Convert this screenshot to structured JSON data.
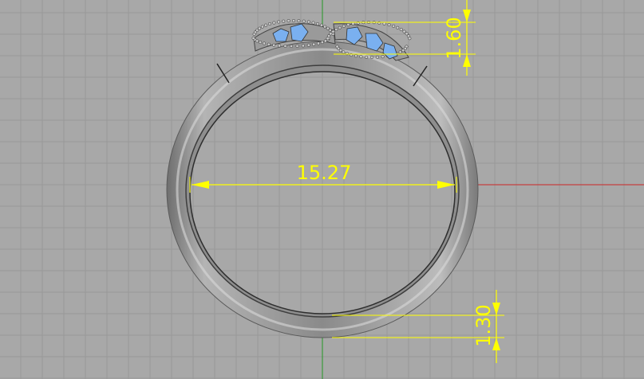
{
  "viewport": {
    "background": "#a8a8a8",
    "grid_color": "#989898",
    "x_axis_color": "#c44040",
    "y_axis_color": "#3a9a3a",
    "dimension_color": "#ffff00",
    "gem_color": "#7ab0f0"
  },
  "dimensions": {
    "inner_diameter": "15.27",
    "top_thickness": "1.60",
    "bottom_thickness": "1.30"
  }
}
